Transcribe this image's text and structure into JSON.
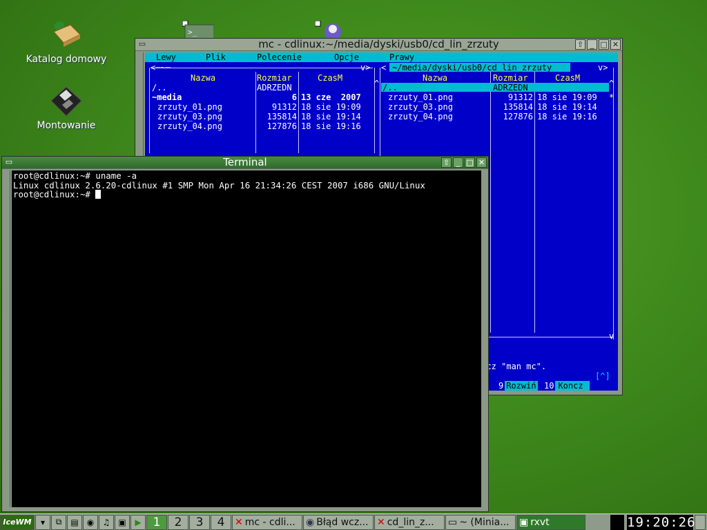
{
  "desktop": {
    "icons": [
      {
        "label": "Katalog domowy"
      },
      {
        "label": "Montowanie"
      }
    ]
  },
  "mc_window": {
    "title": "mc - cdlinux:~/media/dyski/usb0/cd_lin_zrzuty",
    "menu": [
      "Lewy",
      "Plik",
      "Polecenie",
      "Opcje",
      "Prawy"
    ],
    "left_panel": {
      "path": "~",
      "headers": [
        "Nazwa",
        "Rozmiar",
        "CzasM"
      ],
      "rows": [
        {
          "name": "/..",
          "size": "ADRZEDN",
          "time": ""
        },
        {
          "name": "~media",
          "size": "6",
          "time": "13 cze  2007"
        },
        {
          "name": "zrzuty_01.png",
          "size": "91312",
          "time": "18 sie 19:09"
        },
        {
          "name": "zrzuty_03.png",
          "size": "135814",
          "time": "18 sie 19:14"
        },
        {
          "name": "zrzuty_04.png",
          "size": "127876",
          "time": "18 sie 19:16"
        }
      ]
    },
    "right_panel": {
      "path": "~/media/dyski/usb0/cd_lin_zrzuty",
      "headers": [
        "Nazwa",
        "Rozmiar",
        "CzasM"
      ],
      "rows": [
        {
          "name": "/..",
          "size": "ADRZEDN",
          "time": ""
        },
        {
          "name": "zrzuty_01.png",
          "size": "91312",
          "time": "18 sie 19:09"
        },
        {
          "name": "zrzuty_03.png",
          "size": "135814",
          "time": "18 sie 19:14"
        },
        {
          "name": "zrzuty_04.png",
          "size": "127876",
          "time": "18 sie 19:16"
        }
      ]
    },
    "hint": "pacz \"man mc\".",
    "cmd_hint": "[^]",
    "fkeys": [
      {
        "num": "9",
        "label": "Rozwiń"
      },
      {
        "num": "10",
        "label": "Koncz"
      }
    ]
  },
  "terminal_window": {
    "title": "Terminal",
    "lines": [
      "root@cdlinux:~# uname -a",
      "Linux cdlinux 2.6.20-cdlinux #1 SMP Mon Apr 16 21:34:26 CEST 2007 i686 GNU/Linux",
      "root@cdlinux:~# "
    ]
  },
  "taskbar": {
    "start_label": "IceWM",
    "workspaces": [
      "1",
      "2",
      "3",
      "4"
    ],
    "active_workspace": "1",
    "tasks": [
      {
        "label": "mc - cdli..."
      },
      {
        "label": "Błąd wcz..."
      },
      {
        "label": "cd_lin_z..."
      },
      {
        "label": "~ (Minia..."
      },
      {
        "label": "rxvt"
      }
    ],
    "clock": "19:20:26"
  }
}
